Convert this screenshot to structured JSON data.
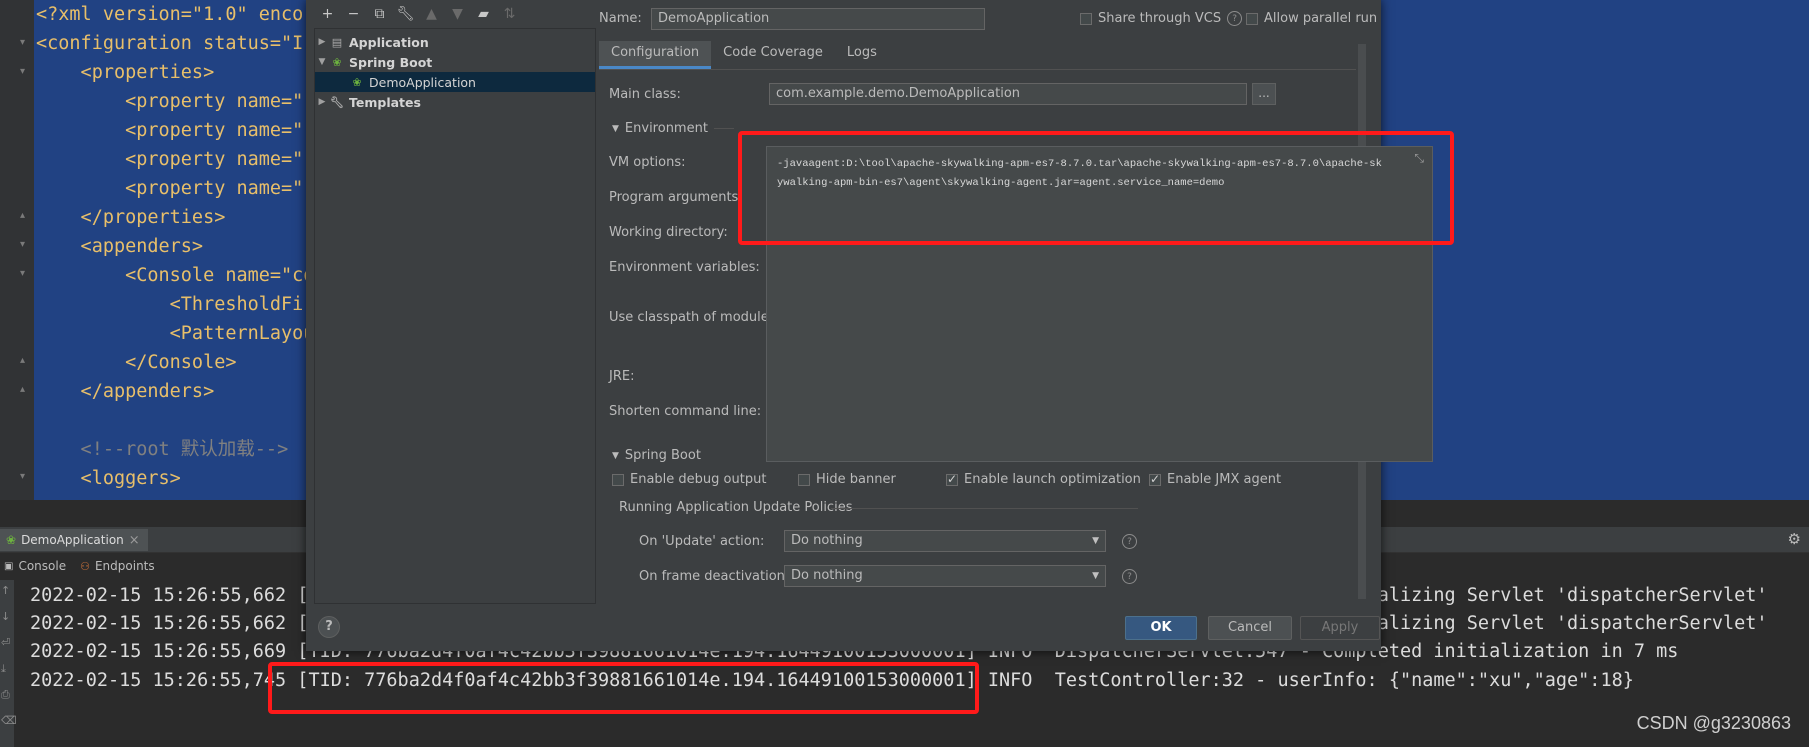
{
  "editor": {
    "lines": [
      "<?xml version=\"1.0\" enco",
      "<configuration status=\"I",
      "    <properties>",
      "        <property name=\"",
      "        <property name=\"",
      "        <property name=\"",
      "        <property name=\"",
      "    </properties>",
      "    <appenders>",
      "        <Console name=\"co",
      "            <ThresholdFi",
      "            <PatternLayou",
      "        </Console>",
      "    </appenders>",
      "",
      "    <!--root 默认加载-->",
      "    <loggers>"
    ]
  },
  "toolwindow": {
    "tab_label": "DemoApplication",
    "close_glyph": "×",
    "subtabs": [
      "Console",
      "Endpoints"
    ],
    "log_lines": [
      "2022-02-15 15:26:55,662 [TID: 776ba2d4f0af4c42bb3f39881661014e.194.16449100153000001] INFO  DispatcherServlet:525 - Initializing Servlet 'dispatcherServlet'",
      "2022-02-15 15:26:55,662 [TID: 776ba2d4f0af4c42bb3f39881661014e.194.16449100153000001] INFO  DispatcherServlet:525 - Initializing Servlet 'dispatcherServlet'",
      "2022-02-15 15:26:55,669 [TID: 776ba2d4f0af4c42bb3f39881661014e.194.16449100153000001] INFO  DispatcherServlet:547 - Completed initialization in 7 ms",
      "2022-02-15 15:26:55,745 [TID: 776ba2d4f0af4c42bb3f39881661014e.194.16449100153000001] INFO  TestController:32 - userInfo: {\"name\":\"xu\",\"age\":18}"
    ],
    "watermark": "CSDN @g3230863"
  },
  "dialog": {
    "tree": [
      {
        "label": "Application",
        "expanded": false
      },
      {
        "label": "Spring Boot",
        "expanded": true
      },
      {
        "label": "DemoApplication",
        "child": true
      },
      {
        "label": "Templates",
        "expanded": false
      }
    ],
    "name_label": "Name:",
    "name_value": "DemoApplication",
    "share_vcs_label": "Share through VCS",
    "allow_parallel_label": "Allow parallel run",
    "tabs": [
      "Configuration",
      "Code Coverage",
      "Logs"
    ],
    "main_class_label": "Main class:",
    "main_class_value": "com.example.demo.DemoApplication",
    "browse_label": "...",
    "environment_label": "Environment",
    "vm_options_label": "VM options:",
    "vm_options_value": "-javaagent:D:\\tool\\apache-skywalking-apm-es7-8.7.0.tar\\apache-skywalking-apm-es7-8.7.0\\apache-skywalking-apm-bin-es7\\agent\\skywalking-agent.jar=agent.service_name=demo",
    "program_args_label": "Program arguments:",
    "working_dir_label": "Working directory:",
    "env_vars_label": "Environment variables:",
    "classpath_label": "Use classpath of module:",
    "jre_label": "JRE:",
    "shorten_label": "Shorten command line:",
    "springboot_label": "Spring Boot",
    "debug_output_label": "Enable debug output",
    "hide_banner_label": "Hide banner",
    "launch_opt_label": "Enable launch optimization",
    "jmx_label": "Enable JMX agent",
    "policies_label": "Running Application Update Policies",
    "update_action_label": "On 'Update' action:",
    "update_action_value": "Do nothing",
    "frame_deact_label": "On frame deactivation:",
    "frame_deact_value": "Do nothing",
    "ok_label": "OK",
    "cancel_label": "Cancel",
    "apply_label": "Apply",
    "help_label": "?"
  },
  "colors": {
    "annotation_red": "#ff1a1a",
    "selection_blue": "#214283",
    "primary_button": "#365880"
  }
}
